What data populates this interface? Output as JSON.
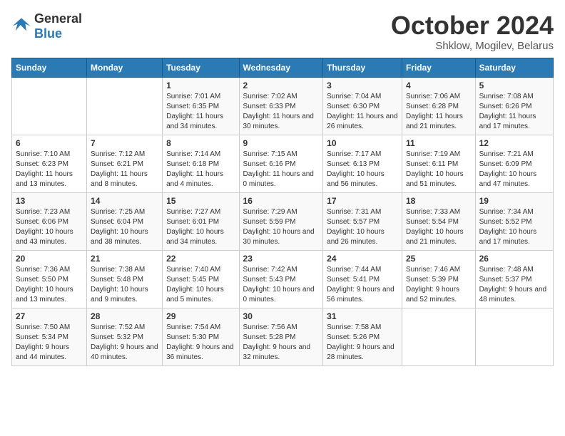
{
  "header": {
    "logo_general": "General",
    "logo_blue": "Blue",
    "month": "October 2024",
    "location": "Shklow, Mogilev, Belarus"
  },
  "days_of_week": [
    "Sunday",
    "Monday",
    "Tuesday",
    "Wednesday",
    "Thursday",
    "Friday",
    "Saturday"
  ],
  "weeks": [
    [
      null,
      null,
      {
        "day": 1,
        "sunrise": "7:01 AM",
        "sunset": "6:35 PM",
        "daylight": "11 hours and 34 minutes."
      },
      {
        "day": 2,
        "sunrise": "7:02 AM",
        "sunset": "6:33 PM",
        "daylight": "11 hours and 30 minutes."
      },
      {
        "day": 3,
        "sunrise": "7:04 AM",
        "sunset": "6:30 PM",
        "daylight": "11 hours and 26 minutes."
      },
      {
        "day": 4,
        "sunrise": "7:06 AM",
        "sunset": "6:28 PM",
        "daylight": "11 hours and 21 minutes."
      },
      {
        "day": 5,
        "sunrise": "7:08 AM",
        "sunset": "6:26 PM",
        "daylight": "11 hours and 17 minutes."
      }
    ],
    [
      {
        "day": 6,
        "sunrise": "7:10 AM",
        "sunset": "6:23 PM",
        "daylight": "11 hours and 13 minutes."
      },
      {
        "day": 7,
        "sunrise": "7:12 AM",
        "sunset": "6:21 PM",
        "daylight": "11 hours and 8 minutes."
      },
      {
        "day": 8,
        "sunrise": "7:14 AM",
        "sunset": "6:18 PM",
        "daylight": "11 hours and 4 minutes."
      },
      {
        "day": 9,
        "sunrise": "7:15 AM",
        "sunset": "6:16 PM",
        "daylight": "11 hours and 0 minutes."
      },
      {
        "day": 10,
        "sunrise": "7:17 AM",
        "sunset": "6:13 PM",
        "daylight": "10 hours and 56 minutes."
      },
      {
        "day": 11,
        "sunrise": "7:19 AM",
        "sunset": "6:11 PM",
        "daylight": "10 hours and 51 minutes."
      },
      {
        "day": 12,
        "sunrise": "7:21 AM",
        "sunset": "6:09 PM",
        "daylight": "10 hours and 47 minutes."
      }
    ],
    [
      {
        "day": 13,
        "sunrise": "7:23 AM",
        "sunset": "6:06 PM",
        "daylight": "10 hours and 43 minutes."
      },
      {
        "day": 14,
        "sunrise": "7:25 AM",
        "sunset": "6:04 PM",
        "daylight": "10 hours and 38 minutes."
      },
      {
        "day": 15,
        "sunrise": "7:27 AM",
        "sunset": "6:01 PM",
        "daylight": "10 hours and 34 minutes."
      },
      {
        "day": 16,
        "sunrise": "7:29 AM",
        "sunset": "5:59 PM",
        "daylight": "10 hours and 30 minutes."
      },
      {
        "day": 17,
        "sunrise": "7:31 AM",
        "sunset": "5:57 PM",
        "daylight": "10 hours and 26 minutes."
      },
      {
        "day": 18,
        "sunrise": "7:33 AM",
        "sunset": "5:54 PM",
        "daylight": "10 hours and 21 minutes."
      },
      {
        "day": 19,
        "sunrise": "7:34 AM",
        "sunset": "5:52 PM",
        "daylight": "10 hours and 17 minutes."
      }
    ],
    [
      {
        "day": 20,
        "sunrise": "7:36 AM",
        "sunset": "5:50 PM",
        "daylight": "10 hours and 13 minutes."
      },
      {
        "day": 21,
        "sunrise": "7:38 AM",
        "sunset": "5:48 PM",
        "daylight": "10 hours and 9 minutes."
      },
      {
        "day": 22,
        "sunrise": "7:40 AM",
        "sunset": "5:45 PM",
        "daylight": "10 hours and 5 minutes."
      },
      {
        "day": 23,
        "sunrise": "7:42 AM",
        "sunset": "5:43 PM",
        "daylight": "10 hours and 0 minutes."
      },
      {
        "day": 24,
        "sunrise": "7:44 AM",
        "sunset": "5:41 PM",
        "daylight": "9 hours and 56 minutes."
      },
      {
        "day": 25,
        "sunrise": "7:46 AM",
        "sunset": "5:39 PM",
        "daylight": "9 hours and 52 minutes."
      },
      {
        "day": 26,
        "sunrise": "7:48 AM",
        "sunset": "5:37 PM",
        "daylight": "9 hours and 48 minutes."
      }
    ],
    [
      {
        "day": 27,
        "sunrise": "7:50 AM",
        "sunset": "5:34 PM",
        "daylight": "9 hours and 44 minutes."
      },
      {
        "day": 28,
        "sunrise": "7:52 AM",
        "sunset": "5:32 PM",
        "daylight": "9 hours and 40 minutes."
      },
      {
        "day": 29,
        "sunrise": "7:54 AM",
        "sunset": "5:30 PM",
        "daylight": "9 hours and 36 minutes."
      },
      {
        "day": 30,
        "sunrise": "7:56 AM",
        "sunset": "5:28 PM",
        "daylight": "9 hours and 32 minutes."
      },
      {
        "day": 31,
        "sunrise": "7:58 AM",
        "sunset": "5:26 PM",
        "daylight": "9 hours and 28 minutes."
      },
      null,
      null
    ]
  ]
}
